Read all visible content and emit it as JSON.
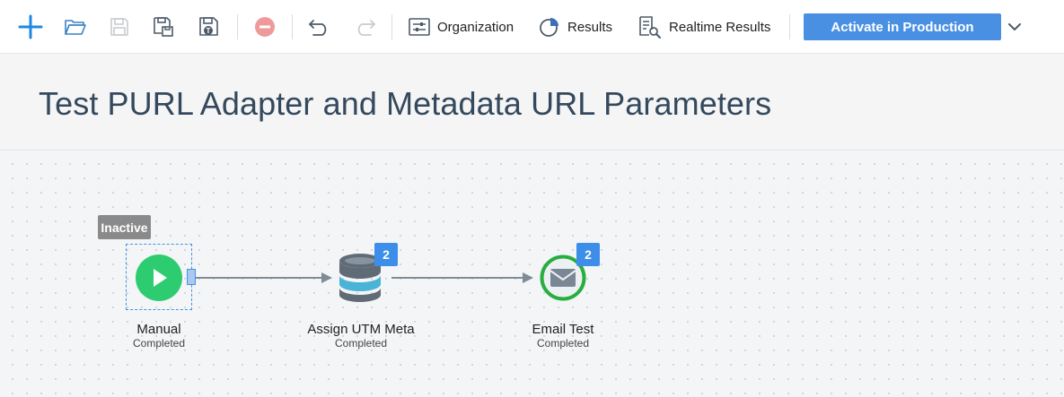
{
  "toolbar": {
    "icons": [
      "plus-icon",
      "folder-open-icon",
      "save-icon",
      "save-as-icon",
      "save-template-icon",
      "remove-icon",
      "undo-icon",
      "redo-icon"
    ],
    "organization_label": "Organization",
    "results_label": "Results",
    "realtime_results_label": "Realtime Results",
    "activate_label": "Activate in Production"
  },
  "page": {
    "title": "Test PURL Adapter and Metadata URL Parameters"
  },
  "workflow": {
    "status_tag": "Inactive",
    "nodes": [
      {
        "name": "Manual",
        "status": "Completed",
        "icon": "play-icon"
      },
      {
        "name": "Assign UTM Meta",
        "status": "Completed",
        "icon": "database-icon",
        "badge": "2"
      },
      {
        "name": "Email Test",
        "status": "Completed",
        "icon": "envelope-icon",
        "badge": "2"
      }
    ]
  },
  "colors": {
    "accent": "#4a90e2",
    "badge": "#3d8ee8",
    "play": "#2ecc71",
    "email_ring": "#27ae3f",
    "db_accent": "#4ab3d8"
  }
}
